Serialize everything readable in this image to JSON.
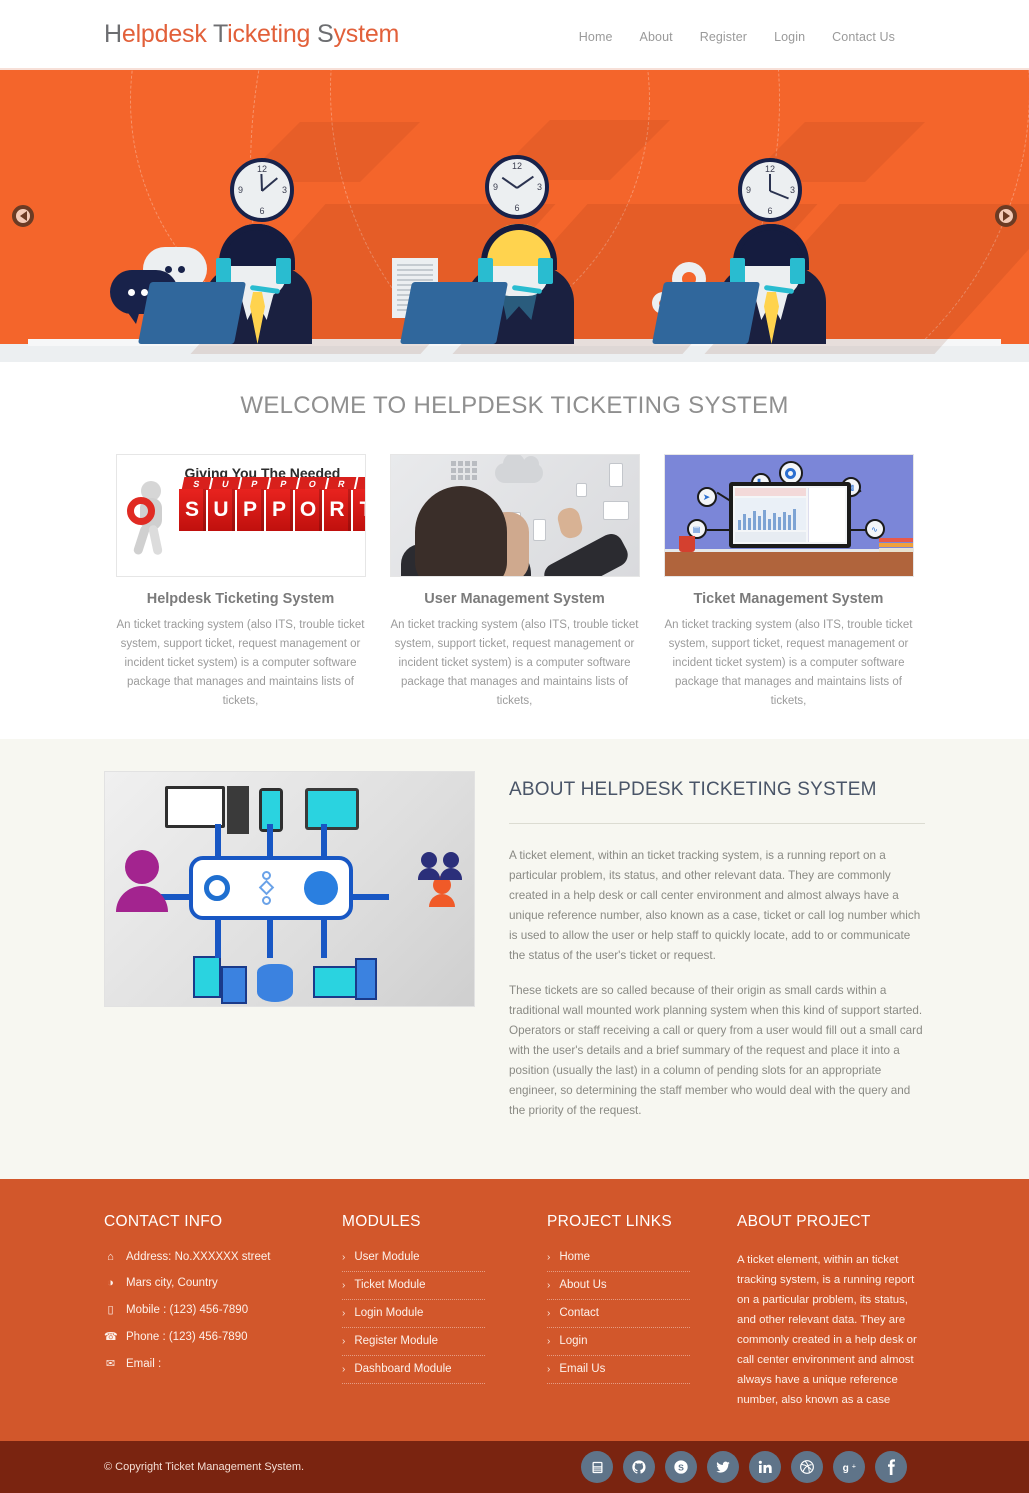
{
  "header": {
    "logo": {
      "full": "Helpdesk Ticketing System",
      "p1": "H",
      "p2": "elpdesk ",
      "p3": "T",
      "p4": "icketing ",
      "p5": "S",
      "p6": "ystem"
    },
    "nav": [
      {
        "label": "Home"
      },
      {
        "label": "About"
      },
      {
        "label": "Register"
      },
      {
        "label": "Login"
      },
      {
        "label": "Contact Us"
      }
    ]
  },
  "hero": {
    "background_color": "#f4652b",
    "prev_icon": "chevron-left-icon",
    "next_icon": "chevron-right-icon",
    "clocks": [
      {
        "numerals": [
          "12",
          "3",
          "6",
          "9"
        ]
      },
      {
        "numerals": [
          "12",
          "3",
          "6",
          "9"
        ]
      },
      {
        "numerals": [
          "12",
          "3",
          "6",
          "9"
        ]
      }
    ]
  },
  "welcome": {
    "title": "WELCOME TO HELPDESK TICKETING SYSTEM",
    "cards": [
      {
        "title": "Helpdesk Ticketing System",
        "text": "An ticket tracking system (also ITS, trouble ticket system, support ticket, request management or incident ticket system) is a computer software package that manages and maintains lists of tickets,",
        "image_caption": "Giving You The Needed",
        "image_word": "SUPPORT"
      },
      {
        "title": "User Management System",
        "text": "An ticket tracking system (also ITS, trouble ticket system, support ticket, request management or incident ticket system) is a computer software package that manages and maintains lists of tickets,"
      },
      {
        "title": "Ticket Management System",
        "text": "An ticket tracking system (also ITS, trouble ticket system, support ticket, request management or incident ticket system) is a computer software package that manages and maintains lists of tickets,"
      }
    ]
  },
  "about": {
    "title": "ABOUT HELPDESK TICKETING SYSTEM",
    "paragraph1": "A ticket element, within an ticket tracking system, is a running report on a particular problem, its status, and other relevant data. They are commonly created in a help desk or call center environment and almost always have a unique reference number, also known as a case, ticket or call log number which is used to allow the user or help staff to quickly locate, add to or communicate the status of the user's ticket or request.",
    "paragraph2": "These tickets are so called because of their origin as small cards within a traditional wall mounted work planning system when this kind of support started. Operators or staff receiving a call or query from a user would fill out a small card with the user's details and a brief summary of the request and place it into a position (usually the last) in a column of pending slots for an appropriate engineer, so determining the staff member who would deal with the query and the priority of the request."
  },
  "footer": {
    "contact": {
      "heading": "CONTACT INFO",
      "rows": [
        {
          "icon": "home-icon",
          "glyph": "⌂",
          "text": "Address: No.XXXXXX street"
        },
        {
          "icon": "globe-icon",
          "glyph": "◑",
          "text": "Mars city, Country"
        },
        {
          "icon": "mobile-icon",
          "glyph": "▯",
          "text": "Mobile : (123) 456-7890"
        },
        {
          "icon": "phone-icon",
          "glyph": "☎",
          "text": "Phone : (123) 456-7890"
        },
        {
          "icon": "envelope-icon",
          "glyph": "✉",
          "text": "Email :"
        }
      ]
    },
    "modules": {
      "heading": "MODULES",
      "items": [
        {
          "label": "User Module"
        },
        {
          "label": "Ticket Module"
        },
        {
          "label": "Login Module"
        },
        {
          "label": "Register Module"
        },
        {
          "label": "Dashboard Module"
        }
      ]
    },
    "project_links": {
      "heading": "PROJECT LINKS",
      "items": [
        {
          "label": "Home"
        },
        {
          "label": "About Us"
        },
        {
          "label": "Contact"
        },
        {
          "label": "Login"
        },
        {
          "label": "Email Us"
        }
      ]
    },
    "about_project": {
      "heading": "ABOUT PROJECT",
      "text": "A ticket element, within an ticket tracking system, is a running report on a particular problem, its status, and other relevant data. They are commonly created in a help desk or call center environment and almost always have a unique reference number, also known as a case"
    },
    "bottom": {
      "copyright": "© Copyright Ticket Management System.",
      "socials": [
        {
          "name": "youtube-icon",
          "glyph": "▶"
        },
        {
          "name": "github-icon",
          "glyph": "●"
        },
        {
          "name": "skype-icon",
          "glyph": "S"
        },
        {
          "name": "twitter-icon",
          "glyph": "✦"
        },
        {
          "name": "linkedin-icon",
          "glyph": "in"
        },
        {
          "name": "dribbble-icon",
          "glyph": "⊕"
        },
        {
          "name": "googleplus-icon",
          "glyph": "g+"
        },
        {
          "name": "facebook-icon",
          "glyph": "f"
        }
      ]
    }
  },
  "colors": {
    "brand_orange": "#f4652b",
    "footer_orange": "#d2572b",
    "footer_bottom": "#7a2410",
    "accent_text": "#e2603a",
    "about_bg": "#f7f7f1"
  }
}
